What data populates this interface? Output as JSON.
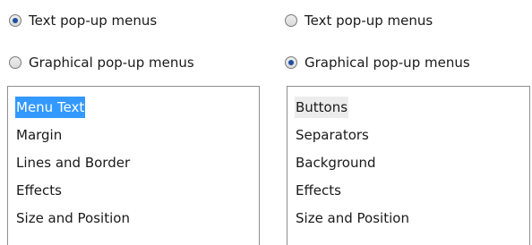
{
  "left_panel": {
    "radio_text": {
      "label": "Text pop-up menus",
      "checked": true
    },
    "radio_graphical": {
      "label": "Graphical pop-up menus",
      "checked": false
    },
    "list": {
      "items": [
        "Menu Text",
        "Margin",
        "Lines and Border",
        "Effects",
        "Size and Position"
      ],
      "selected_index": 0
    }
  },
  "right_panel": {
    "radio_text": {
      "label": "Text pop-up menus",
      "checked": false
    },
    "radio_graphical": {
      "label": "Graphical pop-up menus",
      "checked": true
    },
    "list": {
      "items": [
        "Buttons",
        "Separators",
        "Background",
        "Effects",
        "Size and Position"
      ],
      "selected_index": 0
    }
  },
  "colors": {
    "selection_active": "#3399ff",
    "selection_inactive": "#ececec",
    "radio_dot": "#1f4f9e"
  }
}
